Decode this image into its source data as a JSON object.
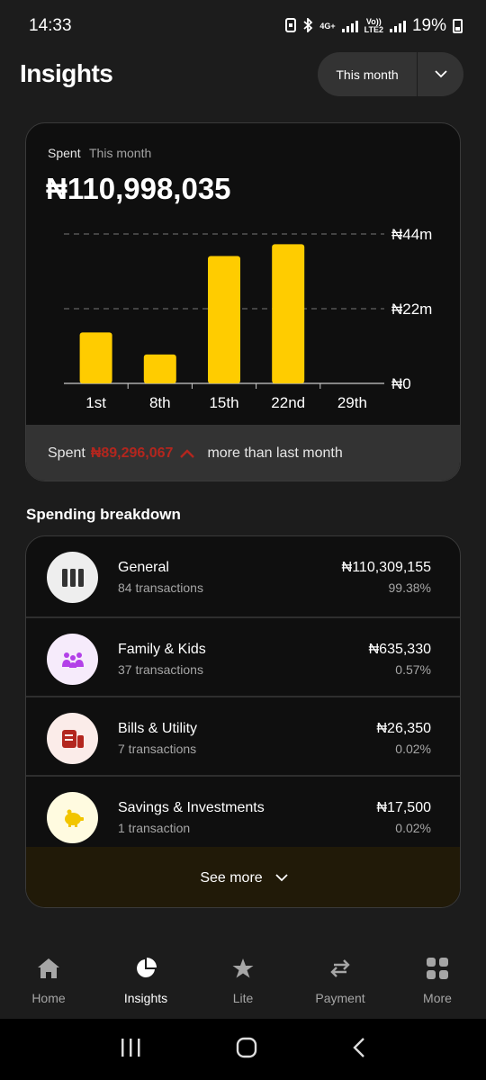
{
  "status_bar": {
    "time": "14:33",
    "network_top": "4G+",
    "volte_top": "Vo))",
    "volte_bottom": "LTE2",
    "battery": "19%",
    "icons": [
      "screenshot-icon",
      "bluetooth-icon",
      "signal-icon",
      "battery-icon"
    ]
  },
  "header": {
    "title": "Insights",
    "period_selector": "This month"
  },
  "spend_card": {
    "label": "Spent",
    "period": "This month",
    "amount": "₦110,998,035",
    "compare_prefix": "Spent",
    "compare_amount": "₦89,296,067",
    "compare_suffix": "more than last month",
    "colors": {
      "bar": "#ffcc00",
      "compare_amount": "#b3261e"
    }
  },
  "chart_data": {
    "type": "bar",
    "categories": [
      "1st",
      "8th",
      "15th",
      "22nd",
      "29th"
    ],
    "values": [
      15,
      8.5,
      37.5,
      41,
      0
    ],
    "y_tick_labels": [
      "₦44m",
      "₦22m",
      "₦0"
    ],
    "y_ticks": [
      44,
      22,
      0
    ],
    "ylim": [
      0,
      44
    ],
    "unit": "₦ millions",
    "grid": "dashed horizontal at ticks"
  },
  "breakdown": {
    "title": "Spending breakdown",
    "items": [
      {
        "name": "General",
        "count": "84 transactions",
        "amount": "₦110,309,155",
        "percent": "99.38%",
        "icon": "columns-icon",
        "icon_bg": "#eeeeee",
        "icon_color": "#333333"
      },
      {
        "name": "Family & Kids",
        "count": "37 transactions",
        "amount": "₦635,330",
        "percent": "0.57%",
        "icon": "family-icon",
        "icon_bg": "#f6ebfb",
        "icon_color": "#b341e8"
      },
      {
        "name": "Bills & Utility",
        "count": "7 transactions",
        "amount": "₦26,350",
        "percent": "0.02%",
        "icon": "receipt-icon",
        "icon_bg": "#fbece9",
        "icon_color": "#b3261e"
      },
      {
        "name": "Savings & Investments",
        "count": "1 transaction",
        "amount": "₦17,500",
        "percent": "0.02%",
        "icon": "piggy-bank-icon",
        "icon_bg": "#fffbe0",
        "icon_color": "#f2c500"
      }
    ],
    "see_more": "See more"
  },
  "bottom_nav": [
    {
      "label": "Home",
      "icon": "home-icon",
      "active": false
    },
    {
      "label": "Insights",
      "icon": "pie-chart-icon",
      "active": true
    },
    {
      "label": "Lite",
      "icon": "star-icon",
      "active": false
    },
    {
      "label": "Payment",
      "icon": "transfer-icon",
      "active": false
    },
    {
      "label": "More",
      "icon": "grid-icon",
      "active": false
    }
  ]
}
